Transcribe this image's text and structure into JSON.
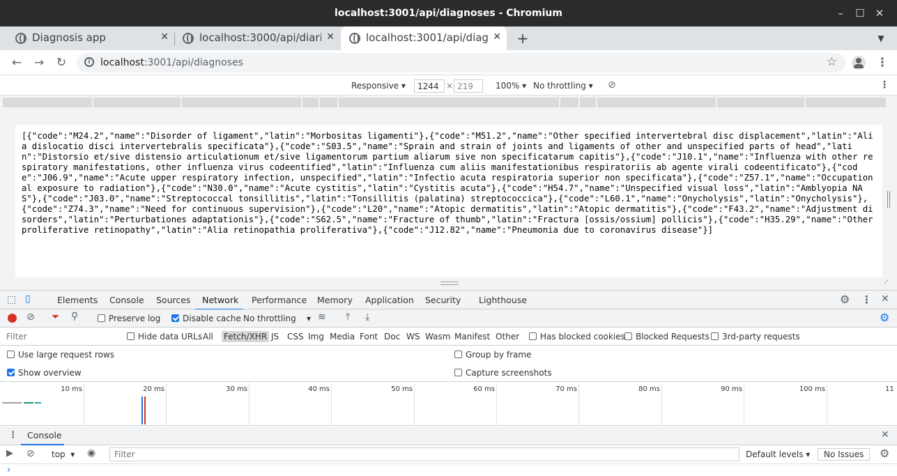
{
  "window": {
    "title": "localhost:3001/api/diagnoses - Chromium"
  },
  "tabs": [
    {
      "label": "Diagnosis app"
    },
    {
      "label": "localhost:3000/api/diarie"
    },
    {
      "label": "localhost:3001/api/diagno"
    }
  ],
  "address": {
    "host": "localhost",
    "rest": ":3001/api/diagnoses"
  },
  "device_toolbar": {
    "mode": "Responsive",
    "width": "1244",
    "times": "×",
    "height": "219",
    "zoom": "100%",
    "throttling": "No throttling"
  },
  "response_json": "[{\"code\":\"M24.2\",\"name\":\"Disorder of ligament\",\"latin\":\"Morbositas ligamenti\"},{\"code\":\"M51.2\",\"name\":\"Other specified intervertebral disc displacement\",\"latin\":\"Alia dislocatio disci intervertebralis specificata\"},{\"code\":\"S03.5\",\"name\":\"Sprain and strain of joints and ligaments of other and unspecified parts of head\",\"latin\":\"Distorsio et/sive distensio articulationum et/sive ligamentorum partium aliarum sive non specificatarum capitis\"},{\"code\":\"J10.1\",\"name\":\"Influenza with other respiratory manifestations, other influenza virus codeentified\",\"latin\":\"Influenza cum aliis manifestationibus respiratoriis ab agente virali codeentificato\"},{\"code\":\"J06.9\",\"name\":\"Acute upper respiratory infection, unspecified\",\"latin\":\"Infectio acuta respiratoria superior non specificata\"},{\"code\":\"Z57.1\",\"name\":\"Occupational exposure to radiation\"},{\"code\":\"N30.0\",\"name\":\"Acute cystitis\",\"latin\":\"Cystitis acuta\"},{\"code\":\"H54.7\",\"name\":\"Unspecified visual loss\",\"latin\":\"Amblyopia NAS\"},{\"code\":\"J03.0\",\"name\":\"Streptococcal tonsillitis\",\"latin\":\"Tonsillitis (palatina) streptococcica\"},{\"code\":\"L60.1\",\"name\":\"Onycholysis\",\"latin\":\"Onycholysis\"},{\"code\":\"Z74.3\",\"name\":\"Need for continuous supervision\"},{\"code\":\"L20\",\"name\":\"Atopic dermatitis\",\"latin\":\"Atopic dermatitis\"},{\"code\":\"F43.2\",\"name\":\"Adjustment disorders\",\"latin\":\"Perturbationes adaptationis\"},{\"code\":\"S62.5\",\"name\":\"Fracture of thumb\",\"latin\":\"Fractura [ossis/ossium] pollicis\"},{\"code\":\"H35.29\",\"name\":\"Other proliferative retinopathy\",\"latin\":\"Alia retinopathia proliferativa\"},{\"code\":\"J12.82\",\"name\":\"Pneumonia due to coronavirus disease\"}]",
  "devtools": {
    "tabs": [
      "Elements",
      "Console",
      "Sources",
      "Network",
      "Performance",
      "Memory",
      "Application",
      "Security",
      "Lighthouse"
    ],
    "active_tab": "Network",
    "network_toolbar": {
      "preserve_log": "Preserve log",
      "disable_cache": "Disable cache",
      "throttling": "No throttling"
    },
    "filter": {
      "placeholder": "Filter",
      "hide_data_urls": "Hide data URLs",
      "types": [
        "All",
        "Fetch/XHR",
        "JS",
        "CSS",
        "Img",
        "Media",
        "Font",
        "Doc",
        "WS",
        "Wasm",
        "Manifest",
        "Other"
      ],
      "active_type": "Fetch/XHR",
      "has_blocked_cookies": "Has blocked cookies",
      "blocked_requests": "Blocked Requests",
      "third_party": "3rd-party requests"
    },
    "options": {
      "large_rows": "Use large request rows",
      "group_by_frame": "Group by frame",
      "show_overview": "Show overview",
      "capture_screenshots": "Capture screenshots"
    },
    "overview_ticks": [
      "10 ms",
      "20 ms",
      "30 ms",
      "40 ms",
      "50 ms",
      "60 ms",
      "70 ms",
      "80 ms",
      "90 ms",
      "100 ms",
      "11"
    ],
    "drawer": {
      "title": "Console",
      "context": "top",
      "filter_placeholder": "Filter",
      "levels": "Default levels",
      "issues": "No Issues"
    }
  }
}
